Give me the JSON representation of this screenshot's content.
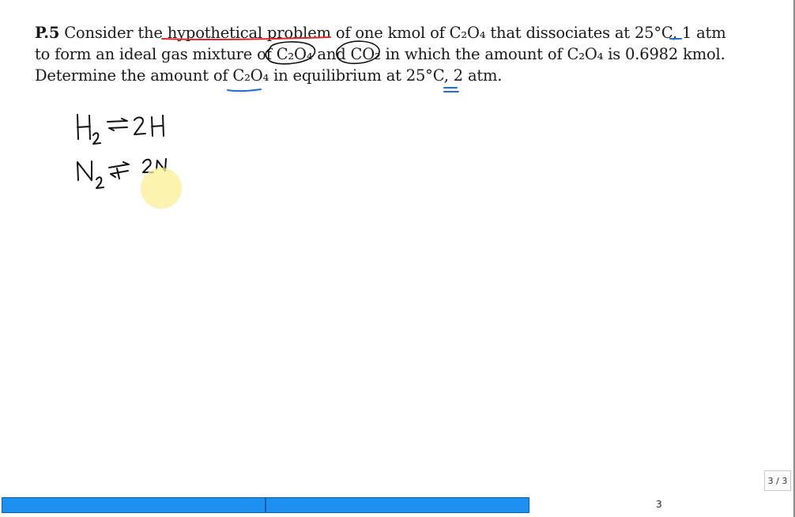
{
  "document": {
    "problem_label": "P.5",
    "line1_text": " Consider the hypothetical problem of one kmol of C₂O₄ that dissociates at 25°C, 1 atm",
    "line2_text": "to form an ideal gas mixture of C₂O₄ and CO₂ in which the amount of C₂O₄ is 0.6982 kmol.",
    "line3_text": "Determine the amount of C₂O₄ in equilibrium at 25°C, 2 atm."
  },
  "handwriting": {
    "reaction1": "H₂ ⇄ 2H",
    "reaction2": "N₂ ⇄ 2N"
  },
  "viewer": {
    "page_counter": "3 / 3",
    "page_number": "3",
    "progress_segments": 2
  },
  "colors": {
    "annotation_red": "#e0262b",
    "annotation_blue": "#1f6fd1",
    "ink_black": "#111111",
    "progress_blue": "#1e90ef",
    "highlight_yellow": "#faf096"
  }
}
